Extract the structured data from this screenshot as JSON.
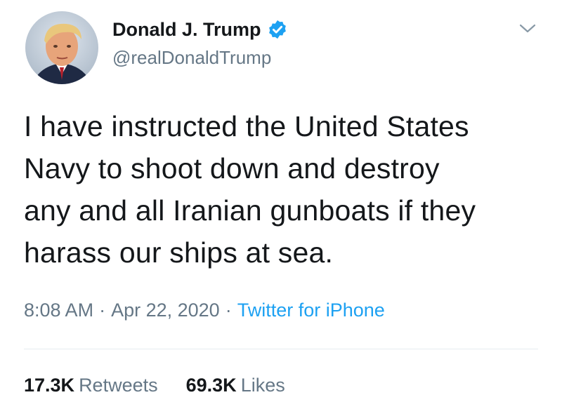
{
  "author": {
    "display_name": "Donald J. Trump",
    "handle": "@realDonaldTrump",
    "verified": true,
    "verified_color": "#1da1f2"
  },
  "tweet": {
    "lines": [
      "I have instructed the United States",
      "Navy to shoot down and destroy",
      "any and all Iranian gunboats if they",
      "harass our ships at sea."
    ]
  },
  "meta": {
    "time": "8:08 AM",
    "separator": "·",
    "date": "Apr 22, 2020",
    "source": "Twitter for iPhone"
  },
  "stats": {
    "retweets_count": "17.3K",
    "retweets_label": "Retweets",
    "likes_count": "69.3K",
    "likes_label": "Likes"
  },
  "icons": {
    "verified": "verified-badge-icon",
    "caret": "chevron-down-icon"
  },
  "colors": {
    "text": "#14171a",
    "secondary": "#657786",
    "link": "#1da1f2",
    "divider": "#e6ecf0"
  }
}
